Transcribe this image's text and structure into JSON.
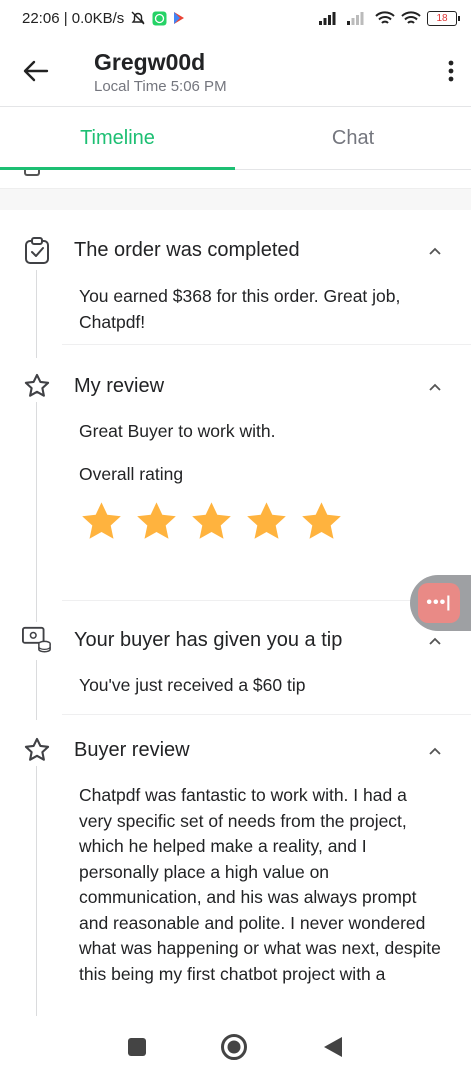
{
  "status_bar": {
    "time_speed": "22:06 | 0.0KB/s",
    "battery": "18"
  },
  "header": {
    "user_name": "Gregw00d",
    "local_time": "Local Time 5:06 PM"
  },
  "tabs": [
    {
      "label": "Timeline",
      "active": true
    },
    {
      "label": "Chat",
      "active": false
    }
  ],
  "events": [
    {
      "icon": "clipboard-check-icon",
      "title": "The order was completed",
      "body": "You earned $368 for this order. Great job, Chatpdf!"
    },
    {
      "icon": "star-outline-icon",
      "title": "My review",
      "body": "Great Buyer to work with.",
      "rating_label": "Overall rating",
      "rating": 5
    },
    {
      "icon": "tip-icon",
      "title": "Your buyer has given you a tip",
      "body": "You've just received a $60 tip"
    },
    {
      "icon": "star-outline-icon",
      "title": "Buyer review",
      "body": "Chatpdf was fantastic to work with.  I had a very specific set of needs from the project, which he helped make a reality, and I personally place a high value on communication, and his was always prompt and reasonable and polite.  I never wondered what was happening or what was next, despite this being my first chatbot project with a"
    }
  ],
  "colors": {
    "accent": "#1dbf73",
    "star": "#ffb33e",
    "text": "#222325",
    "muted": "#74767e"
  }
}
